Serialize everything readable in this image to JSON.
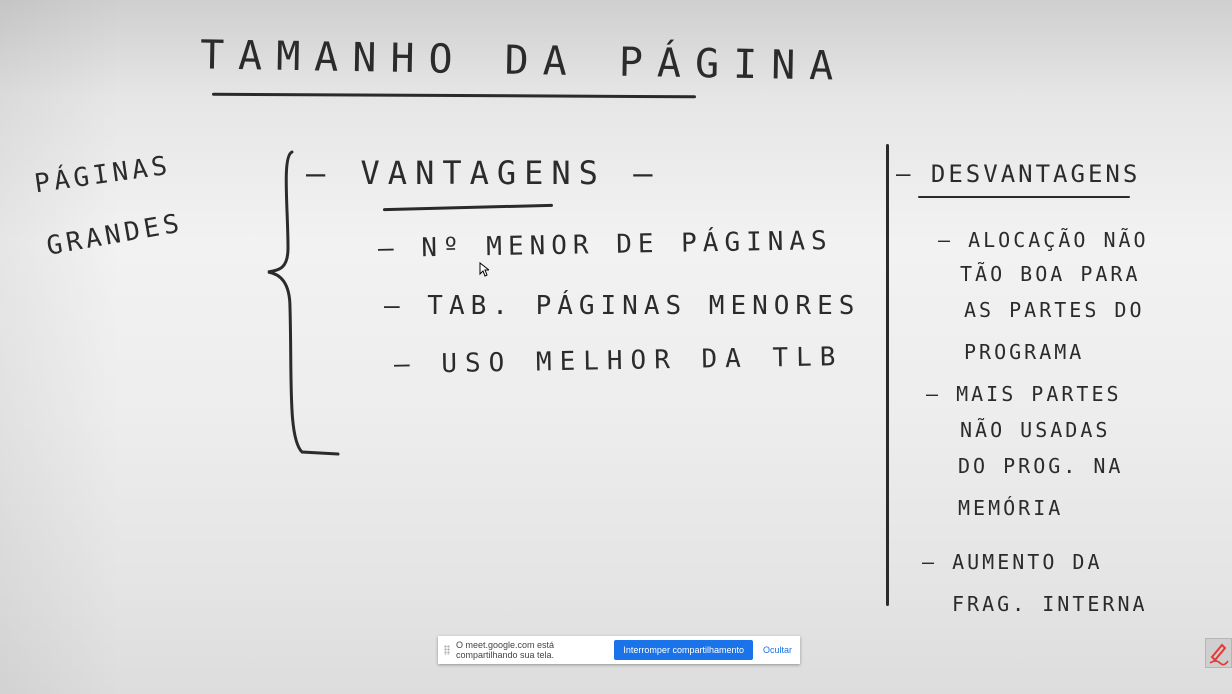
{
  "whiteboard": {
    "title": "TAMANHO DA PÁGINA",
    "left_label": [
      "PÁGINAS",
      "GRANDES"
    ],
    "advantages": {
      "heading": "– VANTAGENS –",
      "items": [
        "– Nº MENOR DE PÁGINAS",
        "– TAB. PÁGINAS MENORES",
        "– USO MELHOR DA TLB"
      ]
    },
    "disadvantages": {
      "heading": "– DESVANTAGENS",
      "items": [
        [
          "– ALOCAÇÃO NÃO",
          "TÃO BOA PARA",
          "AS PARTES DO",
          "PROGRAMA"
        ],
        [
          "– MAIS PARTES",
          "NÃO USADAS",
          "DO PROG. NA",
          "MEMÓRIA"
        ],
        [
          "– AUMENTO DA",
          "FRAG. INTERNA"
        ]
      ]
    }
  },
  "share_banner": {
    "message": "O meet.google.com está compartilhando sua tela.",
    "stop_label": "Interromper compartilhamento",
    "hide_label": "Ocultar"
  },
  "icons": {
    "corner": "pen-icon"
  },
  "colors": {
    "button_blue": "#1a73e8",
    "marker": "#2b2b2b"
  }
}
